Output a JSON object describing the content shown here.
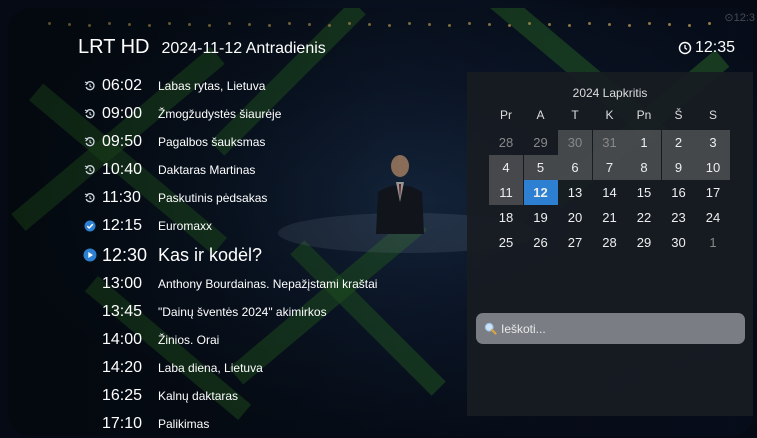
{
  "header": {
    "channel": "LRT HD",
    "date": "2024-11-12 Antradienis",
    "clock": "12:35",
    "top_clock": "12:3"
  },
  "programs": [
    {
      "time": "06:02",
      "title": "Labas rytas, Lietuva",
      "icon": "replay-icon"
    },
    {
      "time": "09:00",
      "title": "Žmogžudystės šiaurėje",
      "icon": "replay-icon"
    },
    {
      "time": "09:50",
      "title": "Pagalbos šauksmas",
      "icon": "replay-icon"
    },
    {
      "time": "10:40",
      "title": "Daktaras Martinas",
      "icon": "replay-icon"
    },
    {
      "time": "11:30",
      "title": "Paskutinis pėdsakas",
      "icon": "replay-icon"
    },
    {
      "time": "12:15",
      "title": "Euromaxx",
      "icon": "check-icon"
    },
    {
      "time": "12:30",
      "title": "Kas ir kodėl?",
      "icon": "play-icon"
    },
    {
      "time": "13:00",
      "title": "Anthony Bourdainas. Nepažįstami kraštai",
      "icon": ""
    },
    {
      "time": "13:45",
      "title": "\"Dainų šventės 2024\" akimirkos",
      "icon": ""
    },
    {
      "time": "14:00",
      "title": "Žinios. Orai",
      "icon": ""
    },
    {
      "time": "14:20",
      "title": "Laba diena, Lietuva",
      "icon": ""
    },
    {
      "time": "16:25",
      "title": "Kalnų daktaras",
      "icon": ""
    },
    {
      "time": "17:10",
      "title": "Palikimas",
      "icon": ""
    }
  ],
  "calendar": {
    "month_label": "2024 Lapkritis",
    "weekdays": [
      "Pr",
      "A",
      "T",
      "K",
      "Pn",
      "Š",
      "S"
    ],
    "weeks": [
      [
        "28",
        "29",
        "30",
        "31",
        "1",
        "2",
        "3"
      ],
      [
        "4",
        "5",
        "6",
        "7",
        "8",
        "9",
        "10"
      ],
      [
        "11",
        "12",
        "13",
        "14",
        "15",
        "16",
        "17"
      ],
      [
        "18",
        "19",
        "20",
        "21",
        "22",
        "23",
        "24"
      ],
      [
        "25",
        "26",
        "27",
        "28",
        "29",
        "30",
        "1"
      ]
    ],
    "selected_day": "12"
  },
  "search": {
    "placeholder": "Ieškoti..."
  },
  "colors": {
    "accent": "#2c7fd1",
    "panel": "#181c22"
  }
}
